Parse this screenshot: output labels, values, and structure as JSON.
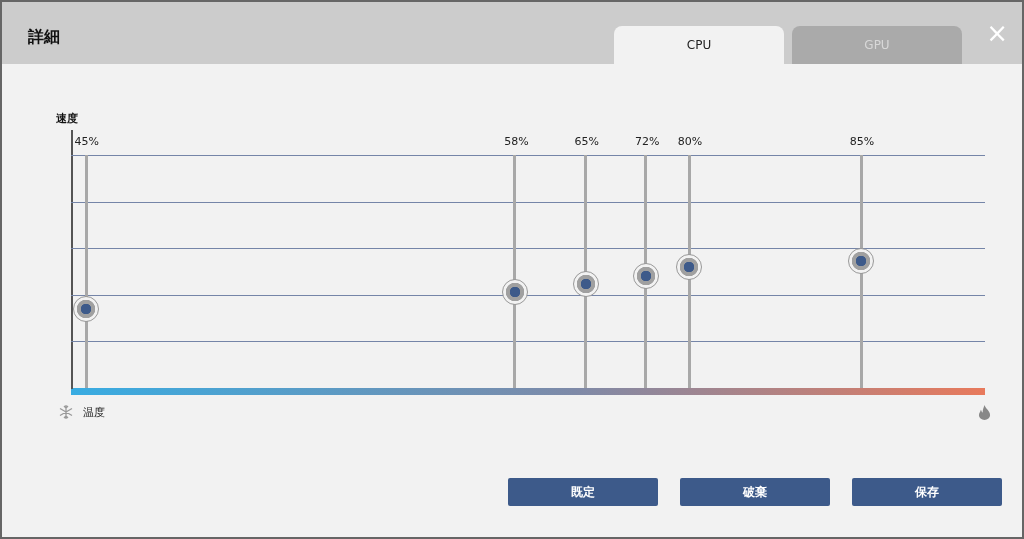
{
  "window": {
    "title": "詳細"
  },
  "tabs": [
    {
      "label": "CPU",
      "selected": true
    },
    {
      "label": "GPU",
      "selected": false
    }
  ],
  "close": "×",
  "curve": {
    "y_label": "速度",
    "x_label": "温度",
    "points": [
      {
        "label": "45%",
        "level": 0.32
      },
      {
        "label": "58%",
        "level": 0.4
      },
      {
        "label": "65%",
        "level": 0.44
      },
      {
        "label": "72%",
        "level": 0.48
      },
      {
        "label": "80%",
        "level": 0.52
      },
      {
        "label": "85%",
        "level": 0.55
      }
    ]
  },
  "buttons": [
    "既定",
    "破棄",
    "保存"
  ]
}
